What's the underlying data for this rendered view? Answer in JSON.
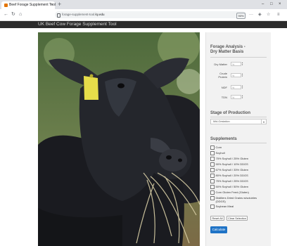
{
  "browser": {
    "tab_title": "Beef Forage Supplement Tool",
    "tab_close": "×",
    "new_tab": "+",
    "url_prefix": "forage-supplement-tool.",
    "url_domain": "ky.edu",
    "zoom": "90%",
    "window_controls": [
      "–",
      "□",
      "×"
    ]
  },
  "app": {
    "title": "UK Beef Cow Forage Supplement Tool"
  },
  "forage": {
    "title_line1": "Forage Analysis -",
    "title_line2": "Dry Matter Basis",
    "fields": [
      {
        "label": "Dry Matter",
        "placeholder": "%"
      },
      {
        "label_line1": "Crude",
        "label_line2": "Protein",
        "placeholder": "%"
      },
      {
        "label": "NDF",
        "placeholder": "%"
      },
      {
        "label": "TDN",
        "placeholder": "%"
      }
    ]
  },
  "stage": {
    "title": "Stage of Production",
    "selected": "Mid-Gestation"
  },
  "supplements": {
    "title": "Supplements",
    "items": [
      "Corn",
      "Soyhull",
      "75% Soyhull / 25% Gluten",
      "90% Soyhull / 10% DDGS",
      "67% Soyhull / 33% Gluten",
      "80% Soyhull / 20% DDGS",
      "75% Soyhull / 25% DDGS",
      "50% Soyhull / 50% Gluten",
      "Corn Gluten Feed (Gluten)",
      "Distillers Dried Grains w/solubles (DDGS)",
      "Soybean Meal"
    ],
    "reset_label": "Reset All",
    "clear_label": "Clear Selection",
    "calculate_label": "Calculate"
  }
}
